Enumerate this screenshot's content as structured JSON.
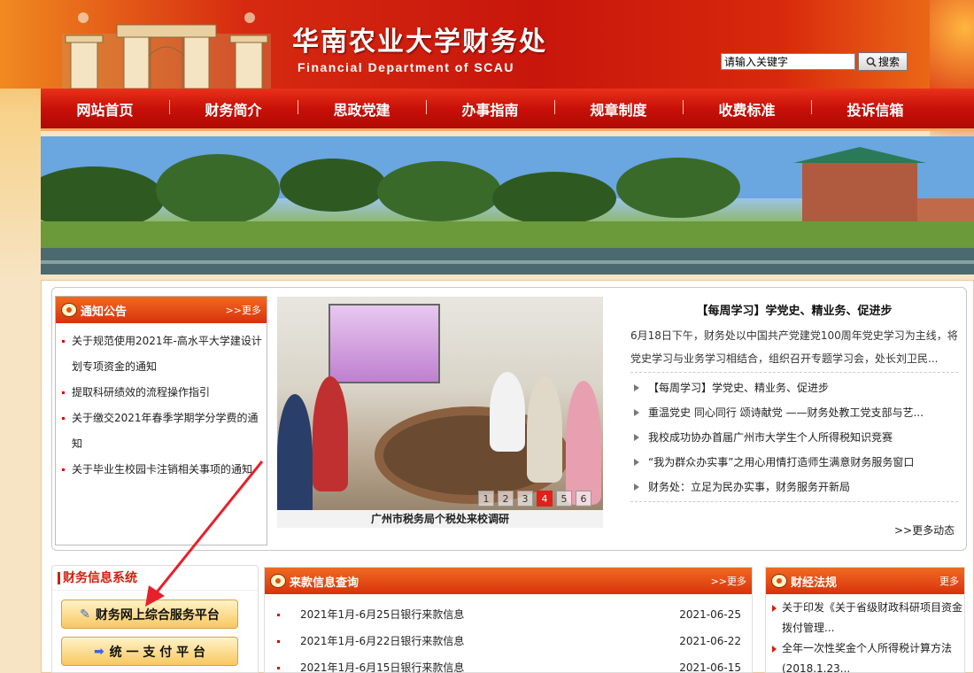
{
  "header": {
    "title": "华南农业大学财务处",
    "subtitle": "Financial Department of SCAU",
    "search_placeholder": "请输入关键字",
    "search_button": "搜索"
  },
  "nav": {
    "items": [
      "网站首页",
      "财务简介",
      "思政党建",
      "办事指南",
      "规章制度",
      "收费标准",
      "投诉信箱"
    ]
  },
  "notice": {
    "title": "通知公告",
    "more": ">>更多",
    "items": [
      "关于规范使用2021年-高水平大学建设计划专项资金的通知",
      "提取科研绩效的流程操作指引",
      "关于缴交2021年春季学期学分学费的通知",
      "关于毕业生校园卡注销相关事项的通知"
    ]
  },
  "slideshow": {
    "caption": "广州市税务局个税处来校调研",
    "pages": [
      "1",
      "2",
      "3",
      "4",
      "5",
      "6"
    ],
    "active_page": 4
  },
  "news": {
    "headline": "【每周学习】学党史、精业务、促进步",
    "summary": "6月18日下午，财务处以中国共产党建党100周年党史学习为主线，将党史学习与业务学习相结合，组织召开专题学习会，处长刘卫民...",
    "items": [
      "【每周学习】学党史、精业务、促进步",
      "重温党史 同心同行 颂诗献党 ——财务处教工党支部与艺...",
      "我校成功协办首届广州市大学生个人所得税知识竞赛",
      "“我为群众办实事”之用心用情打造师生满意财务服务窗口",
      "财务处：立足为民办实事，财务服务开新局"
    ],
    "more": ">>更多动态"
  },
  "finance_system": {
    "title": "财务信息系统",
    "buttons": [
      "财务网上综合服务平台",
      "统 一 支 付 平 台"
    ]
  },
  "payment_query": {
    "title": "来款信息查询",
    "more": ">>更多",
    "rows": [
      {
        "text": "2021年1月-6月25日银行来款信息",
        "date": "2021-06-25"
      },
      {
        "text": "2021年1月-6月22日银行来款信息",
        "date": "2021-06-22"
      },
      {
        "text": "2021年1月-6月15日银行来款信息",
        "date": "2021-06-15"
      }
    ]
  },
  "regulations": {
    "title": "财经法规",
    "more": "更多",
    "items": [
      "关于印发《关于省级财政科研项目资金拨付管理...",
      "全年一次性奖金个人所得税计算方法(2018.1.23..."
    ]
  }
}
